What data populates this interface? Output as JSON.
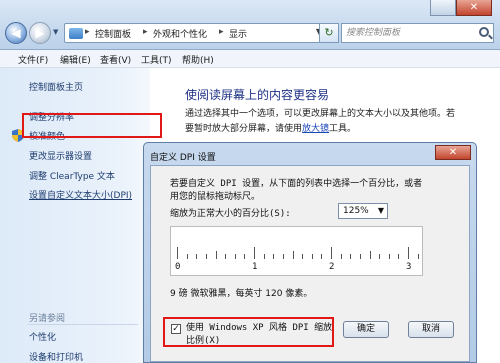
{
  "window": {
    "close_glyph": "✕"
  },
  "address_bar": {
    "breadcrumbs": [
      "控制面板",
      "外观和个性化",
      "显示"
    ],
    "separator": "▸",
    "search_placeholder": "搜索控制面板"
  },
  "menu": {
    "items": [
      "文件(F)",
      "编辑(E)",
      "查看(V)",
      "工具(T)",
      "帮助(H)"
    ]
  },
  "sidebar": {
    "home_label": "控制面板主页",
    "items": [
      {
        "label": "调整分辨率",
        "icon": ""
      },
      {
        "label": "校准颜色",
        "icon": "shield-icon"
      },
      {
        "label": "更改显示器设置",
        "icon": ""
      },
      {
        "label": "调整 ClearType 文本",
        "icon": ""
      },
      {
        "label": "设置自定义文本大小(DPI)",
        "icon": ""
      }
    ],
    "see_also_label": "另请参阅",
    "see_also_items": [
      "个性化",
      "设备和打印机"
    ]
  },
  "main": {
    "title": "使阅读屏幕上的内容更容易",
    "desc_line1": "通过选择其中一个选项，可以更改屏幕上的文本大小以及其他项。若",
    "desc_line2_before": "要暂时放大部分屏幕，请使用",
    "desc_line2_link": "放大镜",
    "desc_line2_after": "工具。"
  },
  "dpi_dialog": {
    "title": "自定义 DPI 设置",
    "desc_line1": "若要自定义 DPI 设置，从下面的列表中选择一个百分比，或者",
    "desc_line2": "用您的鼠标拖动标尺。",
    "scale_label": "缩放为正常大小的百分比(S):",
    "scale_value": "125%",
    "ruler_labels": [
      "0",
      "1",
      "2",
      "3"
    ],
    "font_sample": "9 磅 微软雅黑，每英寸 120 像素。",
    "compat_line1": "使用 Windows XP 风格 DPI 缩放",
    "compat_line2": "比例(X)",
    "compat_checked": true,
    "ok_label": "确定",
    "cancel_label": "取消"
  },
  "colors": {
    "highlight": "#e01818",
    "title_blue": "#1e3287",
    "link_blue": "#1a47b8"
  }
}
